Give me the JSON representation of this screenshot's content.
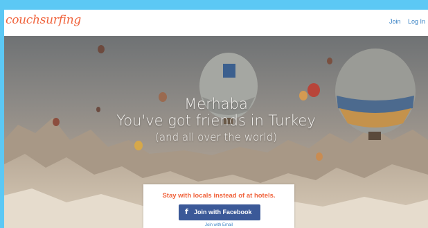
{
  "header": {
    "logo": "couchsurfing",
    "nav": {
      "join": "Join",
      "login": "Log In"
    }
  },
  "hero": {
    "greeting": "Merhaba",
    "headline": "You've got friends in Turkey",
    "subheadline": "(and all over the world)"
  },
  "signup": {
    "tagline": "Stay with locals instead of at hotels.",
    "facebook_icon": "f",
    "facebook_button": "Join with Facebook",
    "email_link": "Join with Email"
  },
  "colors": {
    "brand": "#f0633c",
    "facebook": "#3b5998",
    "link": "#3a83c5",
    "frame": "#5cc8f4"
  }
}
